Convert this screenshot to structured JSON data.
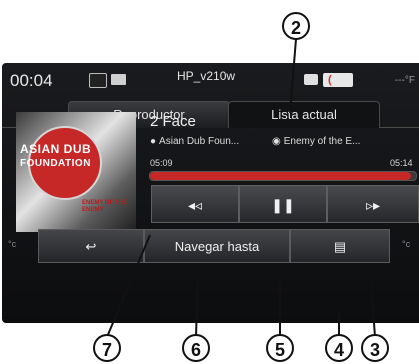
{
  "status": {
    "time": "00:04",
    "device_name": "HP_v210w",
    "temperature": "---°F"
  },
  "tabs": [
    {
      "label": "Reproductor",
      "active": true
    },
    {
      "label": "Lista actual",
      "active": false
    }
  ],
  "album_art": {
    "line1": "ASIAN DUB",
    "line2": "FOUNDATION",
    "sub": "ENEMY OF THE ENEMY"
  },
  "track": {
    "title": "2 Face",
    "artist": "Asian Dub Foun...",
    "album": "Enemy of the E...",
    "elapsed": "05:09",
    "total": "05:14",
    "progress_fraction": 0.98
  },
  "controls": {
    "prev": "◂◃",
    "pause": "❚❚",
    "next": "▹▸"
  },
  "bottom": {
    "back_icon": "↩",
    "browse_label": "Navegar hasta",
    "menu_icon": "▤",
    "left_unit": "°c",
    "right_unit": "°c"
  },
  "callouts": [
    "2",
    "7",
    "6",
    "5",
    "4",
    "3"
  ],
  "colors": {
    "accent": "#c62828",
    "background": "#0c0d0f"
  }
}
